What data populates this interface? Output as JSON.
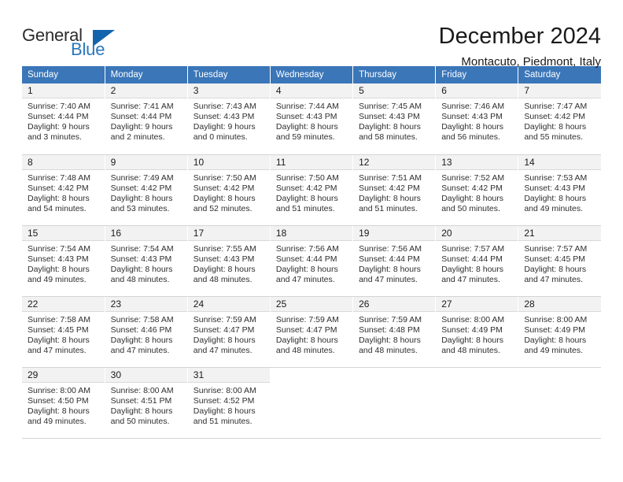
{
  "logo": {
    "word1": "General",
    "word2": "Blue",
    "triangle_color": "#1264ad",
    "blue_text_color": "#2878bd"
  },
  "header": {
    "title": "December 2024",
    "location": "Montacuto, Piedmont, Italy"
  },
  "theme": {
    "header_blue": "#3a76b8",
    "daynum_bg": "#f2f2f2",
    "grid_line": "#d4d4d4"
  },
  "weekdays": [
    "Sunday",
    "Monday",
    "Tuesday",
    "Wednesday",
    "Thursday",
    "Friday",
    "Saturday"
  ],
  "weeks": [
    [
      {
        "day": "1",
        "sunrise": "Sunrise: 7:40 AM",
        "sunset": "Sunset: 4:44 PM",
        "daylight1": "Daylight: 9 hours",
        "daylight2": "and 3 minutes."
      },
      {
        "day": "2",
        "sunrise": "Sunrise: 7:41 AM",
        "sunset": "Sunset: 4:44 PM",
        "daylight1": "Daylight: 9 hours",
        "daylight2": "and 2 minutes."
      },
      {
        "day": "3",
        "sunrise": "Sunrise: 7:43 AM",
        "sunset": "Sunset: 4:43 PM",
        "daylight1": "Daylight: 9 hours",
        "daylight2": "and 0 minutes."
      },
      {
        "day": "4",
        "sunrise": "Sunrise: 7:44 AM",
        "sunset": "Sunset: 4:43 PM",
        "daylight1": "Daylight: 8 hours",
        "daylight2": "and 59 minutes."
      },
      {
        "day": "5",
        "sunrise": "Sunrise: 7:45 AM",
        "sunset": "Sunset: 4:43 PM",
        "daylight1": "Daylight: 8 hours",
        "daylight2": "and 58 minutes."
      },
      {
        "day": "6",
        "sunrise": "Sunrise: 7:46 AM",
        "sunset": "Sunset: 4:43 PM",
        "daylight1": "Daylight: 8 hours",
        "daylight2": "and 56 minutes."
      },
      {
        "day": "7",
        "sunrise": "Sunrise: 7:47 AM",
        "sunset": "Sunset: 4:42 PM",
        "daylight1": "Daylight: 8 hours",
        "daylight2": "and 55 minutes."
      }
    ],
    [
      {
        "day": "8",
        "sunrise": "Sunrise: 7:48 AM",
        "sunset": "Sunset: 4:42 PM",
        "daylight1": "Daylight: 8 hours",
        "daylight2": "and 54 minutes."
      },
      {
        "day": "9",
        "sunrise": "Sunrise: 7:49 AM",
        "sunset": "Sunset: 4:42 PM",
        "daylight1": "Daylight: 8 hours",
        "daylight2": "and 53 minutes."
      },
      {
        "day": "10",
        "sunrise": "Sunrise: 7:50 AM",
        "sunset": "Sunset: 4:42 PM",
        "daylight1": "Daylight: 8 hours",
        "daylight2": "and 52 minutes."
      },
      {
        "day": "11",
        "sunrise": "Sunrise: 7:50 AM",
        "sunset": "Sunset: 4:42 PM",
        "daylight1": "Daylight: 8 hours",
        "daylight2": "and 51 minutes."
      },
      {
        "day": "12",
        "sunrise": "Sunrise: 7:51 AM",
        "sunset": "Sunset: 4:42 PM",
        "daylight1": "Daylight: 8 hours",
        "daylight2": "and 51 minutes."
      },
      {
        "day": "13",
        "sunrise": "Sunrise: 7:52 AM",
        "sunset": "Sunset: 4:42 PM",
        "daylight1": "Daylight: 8 hours",
        "daylight2": "and 50 minutes."
      },
      {
        "day": "14",
        "sunrise": "Sunrise: 7:53 AM",
        "sunset": "Sunset: 4:43 PM",
        "daylight1": "Daylight: 8 hours",
        "daylight2": "and 49 minutes."
      }
    ],
    [
      {
        "day": "15",
        "sunrise": "Sunrise: 7:54 AM",
        "sunset": "Sunset: 4:43 PM",
        "daylight1": "Daylight: 8 hours",
        "daylight2": "and 49 minutes."
      },
      {
        "day": "16",
        "sunrise": "Sunrise: 7:54 AM",
        "sunset": "Sunset: 4:43 PM",
        "daylight1": "Daylight: 8 hours",
        "daylight2": "and 48 minutes."
      },
      {
        "day": "17",
        "sunrise": "Sunrise: 7:55 AM",
        "sunset": "Sunset: 4:43 PM",
        "daylight1": "Daylight: 8 hours",
        "daylight2": "and 48 minutes."
      },
      {
        "day": "18",
        "sunrise": "Sunrise: 7:56 AM",
        "sunset": "Sunset: 4:44 PM",
        "daylight1": "Daylight: 8 hours",
        "daylight2": "and 47 minutes."
      },
      {
        "day": "19",
        "sunrise": "Sunrise: 7:56 AM",
        "sunset": "Sunset: 4:44 PM",
        "daylight1": "Daylight: 8 hours",
        "daylight2": "and 47 minutes."
      },
      {
        "day": "20",
        "sunrise": "Sunrise: 7:57 AM",
        "sunset": "Sunset: 4:44 PM",
        "daylight1": "Daylight: 8 hours",
        "daylight2": "and 47 minutes."
      },
      {
        "day": "21",
        "sunrise": "Sunrise: 7:57 AM",
        "sunset": "Sunset: 4:45 PM",
        "daylight1": "Daylight: 8 hours",
        "daylight2": "and 47 minutes."
      }
    ],
    [
      {
        "day": "22",
        "sunrise": "Sunrise: 7:58 AM",
        "sunset": "Sunset: 4:45 PM",
        "daylight1": "Daylight: 8 hours",
        "daylight2": "and 47 minutes."
      },
      {
        "day": "23",
        "sunrise": "Sunrise: 7:58 AM",
        "sunset": "Sunset: 4:46 PM",
        "daylight1": "Daylight: 8 hours",
        "daylight2": "and 47 minutes."
      },
      {
        "day": "24",
        "sunrise": "Sunrise: 7:59 AM",
        "sunset": "Sunset: 4:47 PM",
        "daylight1": "Daylight: 8 hours",
        "daylight2": "and 47 minutes."
      },
      {
        "day": "25",
        "sunrise": "Sunrise: 7:59 AM",
        "sunset": "Sunset: 4:47 PM",
        "daylight1": "Daylight: 8 hours",
        "daylight2": "and 48 minutes."
      },
      {
        "day": "26",
        "sunrise": "Sunrise: 7:59 AM",
        "sunset": "Sunset: 4:48 PM",
        "daylight1": "Daylight: 8 hours",
        "daylight2": "and 48 minutes."
      },
      {
        "day": "27",
        "sunrise": "Sunrise: 8:00 AM",
        "sunset": "Sunset: 4:49 PM",
        "daylight1": "Daylight: 8 hours",
        "daylight2": "and 48 minutes."
      },
      {
        "day": "28",
        "sunrise": "Sunrise: 8:00 AM",
        "sunset": "Sunset: 4:49 PM",
        "daylight1": "Daylight: 8 hours",
        "daylight2": "and 49 minutes."
      }
    ],
    [
      {
        "day": "29",
        "sunrise": "Sunrise: 8:00 AM",
        "sunset": "Sunset: 4:50 PM",
        "daylight1": "Daylight: 8 hours",
        "daylight2": "and 49 minutes."
      },
      {
        "day": "30",
        "sunrise": "Sunrise: 8:00 AM",
        "sunset": "Sunset: 4:51 PM",
        "daylight1": "Daylight: 8 hours",
        "daylight2": "and 50 minutes."
      },
      {
        "day": "31",
        "sunrise": "Sunrise: 8:00 AM",
        "sunset": "Sunset: 4:52 PM",
        "daylight1": "Daylight: 8 hours",
        "daylight2": "and 51 minutes."
      },
      {
        "day": "",
        "sunrise": "",
        "sunset": "",
        "daylight1": "",
        "daylight2": ""
      },
      {
        "day": "",
        "sunrise": "",
        "sunset": "",
        "daylight1": "",
        "daylight2": ""
      },
      {
        "day": "",
        "sunrise": "",
        "sunset": "",
        "daylight1": "",
        "daylight2": ""
      },
      {
        "day": "",
        "sunrise": "",
        "sunset": "",
        "daylight1": "",
        "daylight2": ""
      }
    ]
  ]
}
